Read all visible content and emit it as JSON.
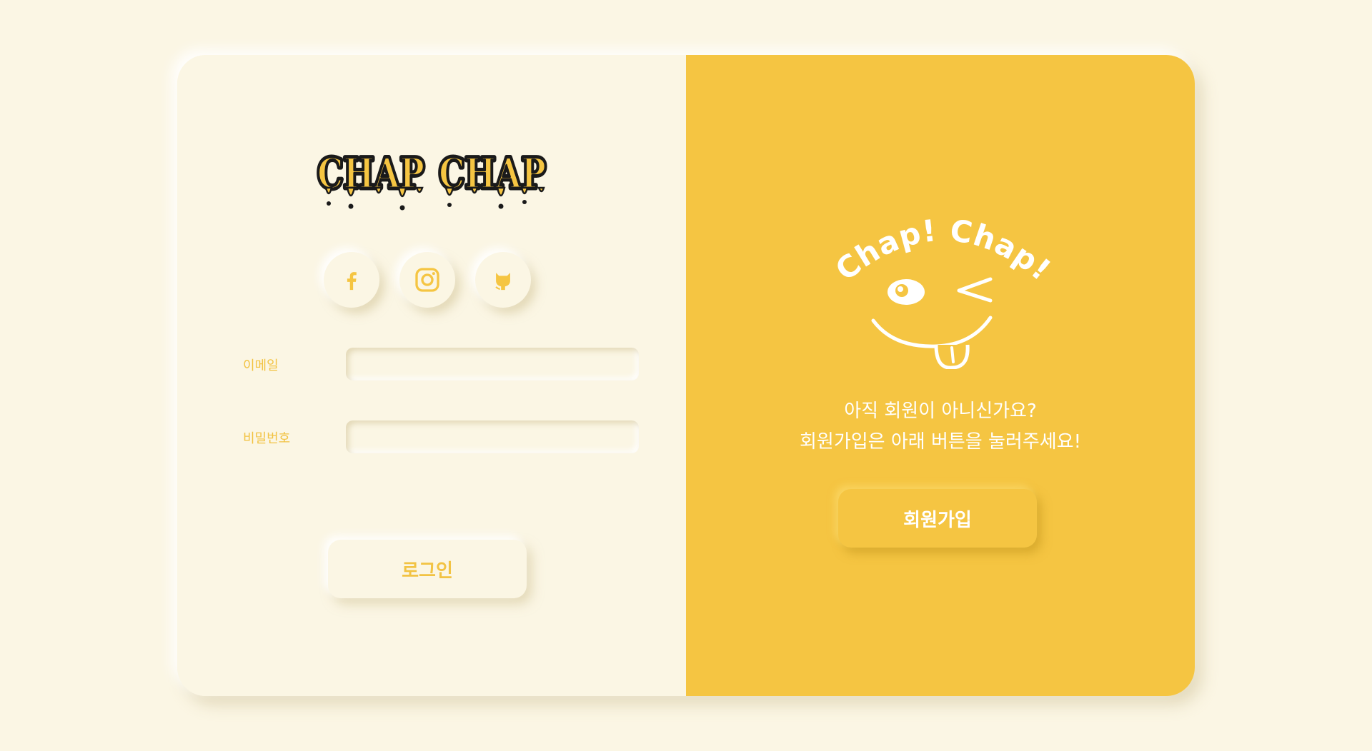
{
  "colors": {
    "background": "#fbf6e4",
    "accent": "#f5c542",
    "accent_text": "#f2c343",
    "white": "#ffffff"
  },
  "login": {
    "logo_text": "CHAP CHAP",
    "social": [
      {
        "name": "facebook",
        "icon": "facebook-icon"
      },
      {
        "name": "instagram",
        "icon": "instagram-icon"
      },
      {
        "name": "github",
        "icon": "github-icon"
      }
    ],
    "email_label": "이메일",
    "email_value": "",
    "password_label": "비밀번호",
    "password_value": "",
    "login_button": "로그인"
  },
  "signup": {
    "mascot_text": "Chap! Chap!",
    "message_line1": "아직 회원이 아니신가요?",
    "message_line2": "회원가입은 아래 버튼을 눌러주세요!",
    "signup_button": "회원가입"
  }
}
